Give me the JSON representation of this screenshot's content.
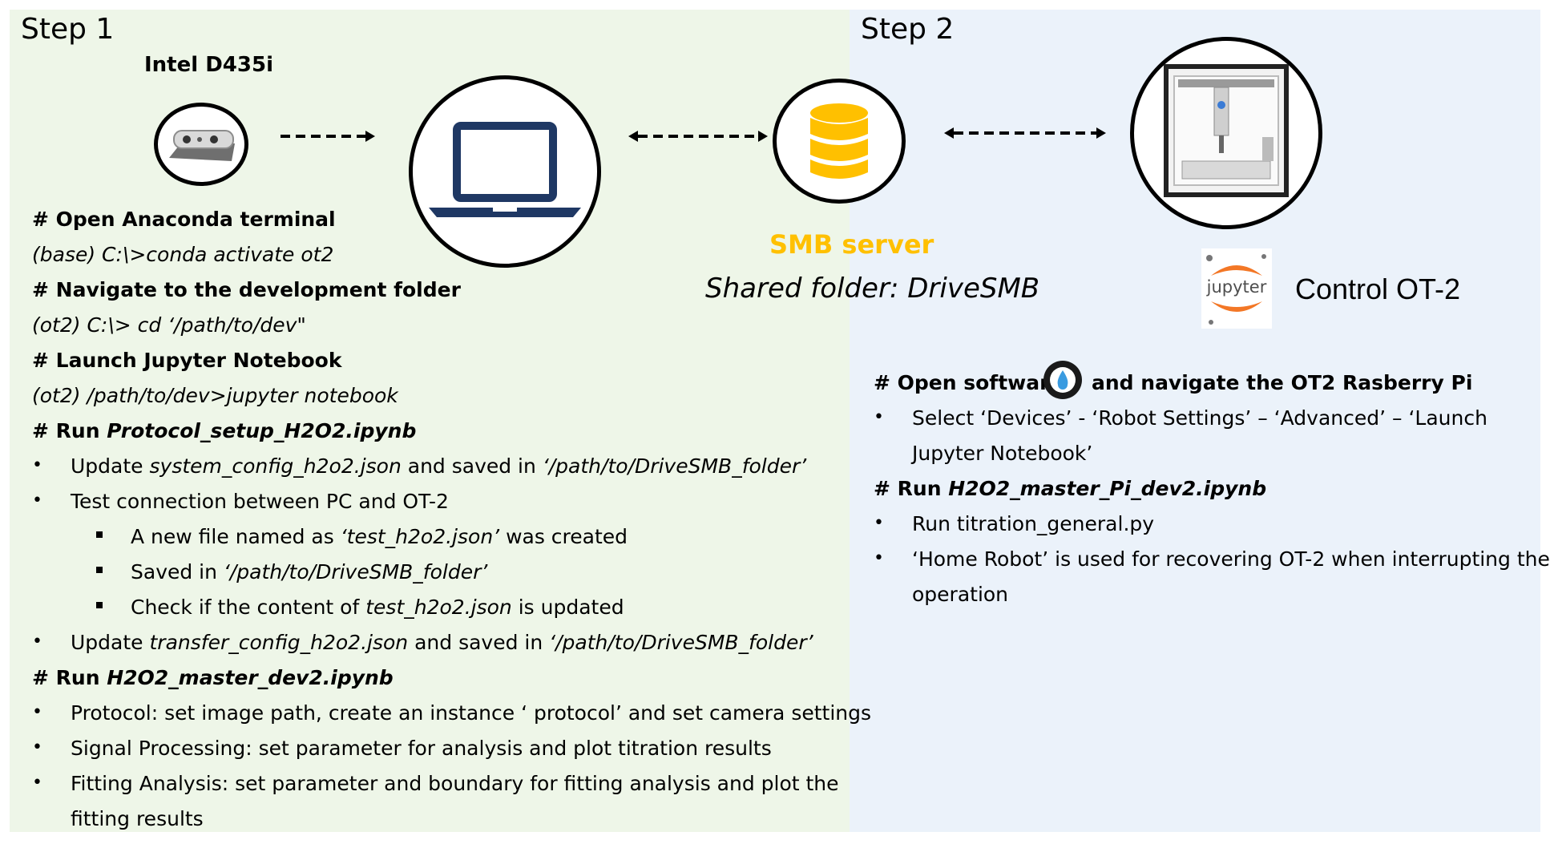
{
  "step1": {
    "title": "Step 1",
    "camera_label": "Intel D435i",
    "lines": [
      {
        "kind": "h",
        "text": "# Open Anaconda terminal"
      },
      {
        "kind": "i",
        "text": "(base) C:\\>conda activate ot2"
      },
      {
        "kind": "h",
        "text": "# Navigate to the development folder"
      },
      {
        "kind": "i",
        "text": "(ot2) C:\\> cd ‘/path/to/dev\""
      },
      {
        "kind": "h",
        "text": "# Launch Jupyter Notebook"
      },
      {
        "kind": "i",
        "text": "(ot2) /path/to/dev>jupyter notebook"
      }
    ],
    "run1": {
      "prefix": "# Run ",
      "file": "Protocol_setup_H2O2.ipynb"
    },
    "b1": {
      "a": "Update ",
      "b": "system_config_h2o2.json",
      "c": " and saved in ",
      "d": "‘/path/to/DriveSMB_folder’"
    },
    "b2": "Test connection between PC and OT-2",
    "s1": {
      "a": "A new file named as ",
      "b": "‘test_h2o2.json’",
      "c": " was created"
    },
    "s2": {
      "a": "Saved in ",
      "b": "‘/path/to/DriveSMB_folder’"
    },
    "s3": {
      "a": "Check if the content of ",
      "b": "test_h2o2.json",
      "c": " is updated"
    },
    "b3": {
      "a": "Update ",
      "b": "transfer_config_h2o2.json",
      "c": " and saved in ",
      "d": "‘/path/to/DriveSMB_folder’"
    },
    "run2": {
      "prefix": "# Run ",
      "file": "H2O2_master_dev2.ipynb"
    },
    "b4": "Protocol: set image path, create an instance ‘ protocol’ and set camera settings",
    "b5": "Signal Processing: set parameter for analysis and plot titration results",
    "b6a": "Fitting Analysis: set parameter and boundary for fitting analysis and plot the",
    "b6b": "fitting results"
  },
  "step2": {
    "title": "Step 2",
    "smb_title": "SMB server",
    "smb_sub": "Shared folder: DriveSMB",
    "control": "Control OT-2",
    "jupyter_logo": "jupyter",
    "open_a": "# Open software",
    "open_b": "and navigate the OT2 Rasberry Pi",
    "b1a": "Select ‘Devices’  - ‘Robot Settings’ – ‘Advanced’ – ‘Launch",
    "b1b": "Jupyter Notebook’",
    "run": {
      "prefix": "# Run ",
      "file": "H2O2_master_Pi_dev2.ipynb"
    },
    "b2": "Run titration_general.py",
    "b3a": "‘Home Robot’ is used for recovering OT-2 when interrupting the",
    "b3b": "operation"
  },
  "colors": {
    "left_panel": "#eef6e8",
    "right_panel": "#ebf2fa",
    "laptop": "#1f3864",
    "database": "#ffc000",
    "smb_title": "#ffc000"
  },
  "icons": [
    "camera-icon",
    "laptop-icon",
    "database-icon",
    "robot-icon",
    "jupyter-logo",
    "opentrons-app-icon"
  ]
}
